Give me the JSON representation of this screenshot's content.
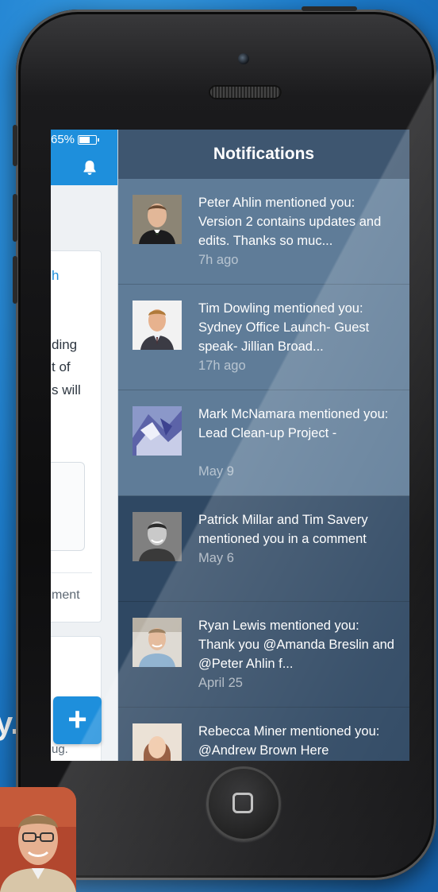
{
  "background": {
    "fragment_text": "y."
  },
  "status_bar": {
    "battery": "65%"
  },
  "left_app": {
    "fragments": [
      "h",
      "ding",
      "t of",
      "s will",
      "ment",
      "ug."
    ],
    "fab_label": "+"
  },
  "panel": {
    "title": "Notifications",
    "items": [
      {
        "text": "Peter Ahlin mentioned you: Version 2 contains updates and edits.  Thanks so muc...",
        "time": "7h ago",
        "state": "unread"
      },
      {
        "text": "Tim Dowling mentioned you: Sydney Office Launch- Guest speak- Jillian Broad...",
        "time": "17h ago",
        "state": "unread"
      },
      {
        "text": "Mark McNamara mentioned you: Lead Clean-up Project -",
        "time": "May 9",
        "state": "unread"
      },
      {
        "text": "Patrick Millar and Tim Savery mentioned you in a comment",
        "time": "May 6",
        "state": "read"
      },
      {
        "text": "Ryan Lewis mentioned you: Thank you @Amanda Breslin and @Peter Ahlin f...",
        "time": "April 25",
        "state": "read"
      },
      {
        "text": "Rebecca Miner mentioned you: @Andrew Brown Here",
        "time": "",
        "state": "read"
      }
    ]
  },
  "colors": {
    "accent": "#1e8fdc",
    "unread_bg": "#5f7c98",
    "read_bg": "#2f4863",
    "header_bg": "#3e5670"
  }
}
